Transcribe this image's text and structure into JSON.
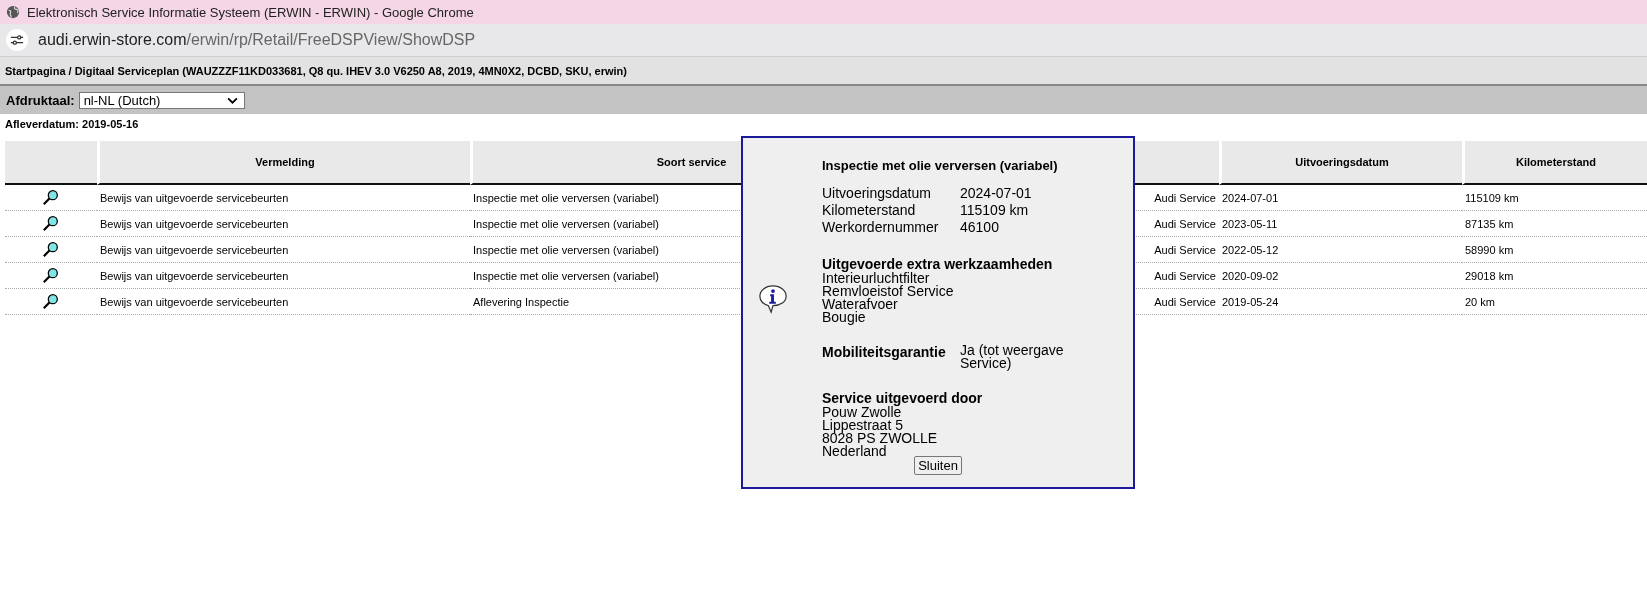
{
  "window": {
    "title": "Elektronisch Service Informatie Systeem (ERWIN - ERWIN) - Google Chrome"
  },
  "address_bar": {
    "host": "audi.erwin-store.com",
    "path": "/erwin/rp/Retail/FreeDSPView/ShowDSP"
  },
  "breadcrumb": "Startpagina / Digitaal Serviceplan (WAUZZZF11KD033681, Q8 qu. IHEV 3.0 V6250 A8, 2019, 4MN0X2, DCBD, SKU, erwin)",
  "print_language": {
    "label": "Afdruktaal:",
    "value": "nl-NL (Dutch)"
  },
  "delivery_date": "Afleverdatum: 2019-05-16",
  "table": {
    "columns": [
      "",
      "Vermelding",
      "Soort service",
      "",
      "Uitvoeringsdatum",
      "Kilometerstand"
    ],
    "rows": [
      {
        "vermelding": "Bewijs van uitgevoerde servicebeurten",
        "soort_service": "Inspectie met olie verversen (variabel)",
        "column_4": "Audi Service",
        "uitvoeringsdatum": "2024-07-01",
        "kilometerstand": "115109 km"
      },
      {
        "vermelding": "Bewijs van uitgevoerde servicebeurten",
        "soort_service": "Inspectie met olie verversen (variabel)",
        "column_4": "Audi Service",
        "uitvoeringsdatum": "2023-05-11",
        "kilometerstand": "87135 km"
      },
      {
        "vermelding": "Bewijs van uitgevoerde servicebeurten",
        "soort_service": "Inspectie met olie verversen (variabel)",
        "column_4": "Audi Service",
        "uitvoeringsdatum": "2022-05-12",
        "kilometerstand": "58990 km"
      },
      {
        "vermelding": "Bewijs van uitgevoerde servicebeurten",
        "soort_service": "Inspectie met olie verversen (variabel)",
        "column_4": "Audi Service",
        "uitvoeringsdatum": "2020-09-02",
        "kilometerstand": "29018 km"
      },
      {
        "vermelding": "Bewijs van uitgevoerde servicebeurten",
        "soort_service": "Aflevering Inspectie",
        "column_4": "Audi Service",
        "uitvoeringsdatum": "2019-05-24",
        "kilometerstand": "20 km"
      }
    ]
  },
  "dialog": {
    "title": "Inspectie met olie verversen (variabel)",
    "details": [
      {
        "label": "Uitvoeringsdatum",
        "value": "2024-07-01"
      },
      {
        "label": "Kilometerstand",
        "value": "115109 km"
      },
      {
        "label": "Werkordernummer",
        "value": "46100"
      }
    ],
    "extra_work": {
      "heading": "Uitgevoerde extra werkzaamheden",
      "items": [
        "Interieurluchtfilter",
        "Remvloeistof Service",
        "Waterafvoer",
        "Bougie"
      ]
    },
    "mobility": {
      "label": "Mobiliteitsgarantie",
      "value": "Ja (tot weergave Service)"
    },
    "performed_by": {
      "heading": "Service uitgevoerd door",
      "lines": [
        "Pouw Zwolle",
        "Lippestraat 5",
        "8028 PS ZWOLLE",
        "Nederland"
      ]
    },
    "close_button": "Sluiten"
  }
}
